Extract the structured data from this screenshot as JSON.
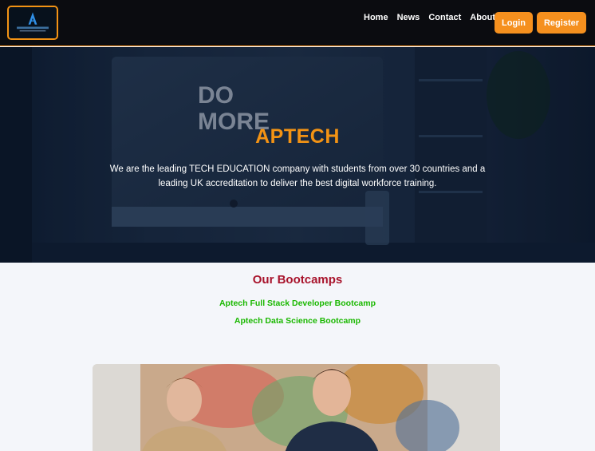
{
  "header": {
    "logo_icon": "aptech-logo-icon",
    "nav": [
      {
        "label": "Home"
      },
      {
        "label": "News"
      },
      {
        "label": "Contact"
      },
      {
        "label": "About"
      }
    ],
    "login_label": "Login",
    "register_label": "Register"
  },
  "hero": {
    "title": "APTECH",
    "text": "We are the leading TECH EDUCATION company with students from over 30 countries and a leading UK accreditation to deliver the best digital workforce training.",
    "background_sign_text": "DO MORE"
  },
  "bootcamps": {
    "title": "Our Bootcamps",
    "items": [
      {
        "label": "Aptech Full Stack Developer Bootcamp"
      },
      {
        "label": "Aptech Data Science Bootcamp"
      }
    ]
  },
  "colors": {
    "accent": "#f5901e",
    "section_title": "#a8132b",
    "link_green": "#1ab800",
    "header_bg": "#0b0c10"
  }
}
